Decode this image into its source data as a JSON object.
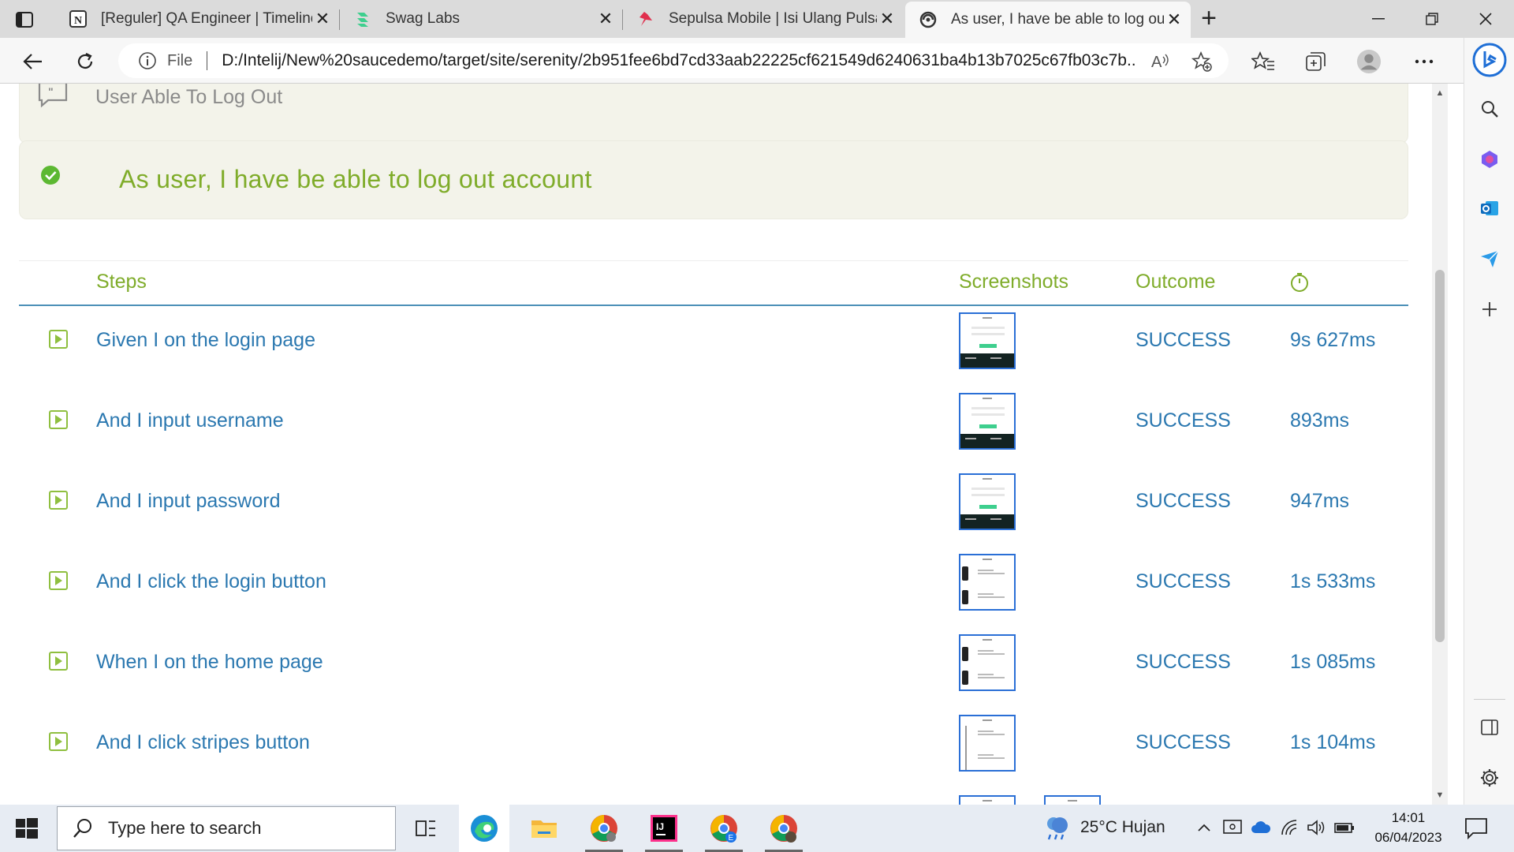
{
  "browser": {
    "tabs": [
      {
        "title": "[Reguler] QA Engineer | Timeline",
        "favicon": "notion-icon",
        "active": false
      },
      {
        "title": "Swag Labs",
        "favicon": "swaglabs-icon",
        "active": false
      },
      {
        "title": "Sepulsa Mobile | Isi Ulang Pulsa S",
        "favicon": "sepulsa-icon",
        "active": false
      },
      {
        "title": "As user, I have be able to log out",
        "favicon": "serenity-icon",
        "active": true
      }
    ],
    "address": {
      "scheme_label": "File",
      "url": "D:/Intelij/New%20saucedemo/target/site/serenity/2b951fee6bd7cd33aab22225cf621549d6240631ba4b13b7025c67fb03c7b..."
    }
  },
  "report": {
    "story_title": "User Able To Log Out",
    "scenario_title": "As user, I have be able to log out account",
    "scenario_status_color": "#7fac2a",
    "columns": {
      "steps": "Steps",
      "screenshots": "Screenshots",
      "outcome": "Outcome"
    },
    "steps": [
      {
        "text": "Given I on the login page",
        "outcome": "SUCCESS",
        "duration": "9s 627ms",
        "shot": "login"
      },
      {
        "text": "And I input username",
        "outcome": "SUCCESS",
        "duration": "893ms",
        "shot": "login"
      },
      {
        "text": "And I input password",
        "outcome": "SUCCESS",
        "duration": "947ms",
        "shot": "login"
      },
      {
        "text": "And I click the login button",
        "outcome": "SUCCESS",
        "duration": "1s 533ms",
        "shot": "products"
      },
      {
        "text": "When I on the home page",
        "outcome": "SUCCESS",
        "duration": "1s 085ms",
        "shot": "products"
      },
      {
        "text": "And I click stripes button",
        "outcome": "SUCCESS",
        "duration": "1s 104ms",
        "shot": "menu"
      }
    ]
  },
  "taskbar": {
    "search_placeholder": "Type here to search",
    "weather": "25°C  Hujan",
    "time": "14:01",
    "date": "06/04/2023"
  }
}
